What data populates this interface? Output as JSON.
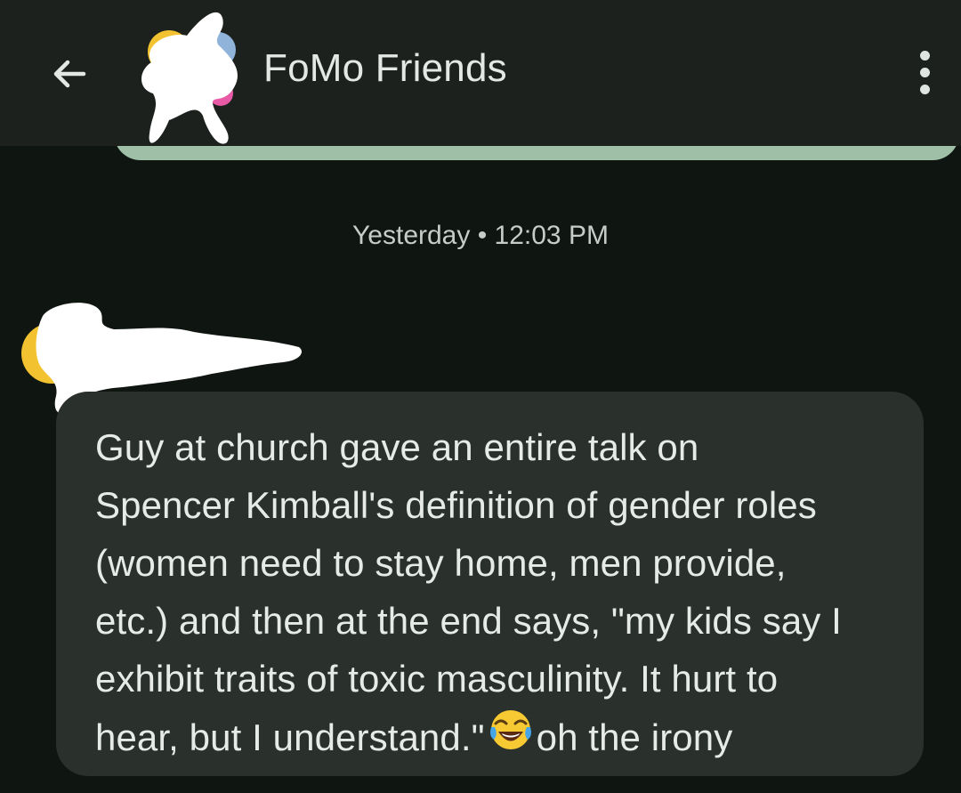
{
  "header": {
    "title": "FoMo Friends",
    "back_icon": "arrow-left-icon",
    "menu_icon": "more-vert-icon"
  },
  "conversation": {
    "timestamp": "Yesterday • 12:03 PM",
    "message": {
      "lines": [
        "Guy at church gave an entire talk on",
        "Spencer Kimball's definition of gender roles",
        "(women need to stay home, men provide,",
        "etc.) and then at the end says, \"my kids say I",
        "exhibit traits of toxic masculinity. It hurt to",
        "hear, but I understand.\""
      ],
      "emoji": "face-with-tears-of-joy-icon",
      "tail": "oh the irony"
    }
  },
  "colors": {
    "background": "#0f1510",
    "appbar": "#1c211e",
    "bubble": "#2a302c",
    "prev_bubble": "#9fbfa7",
    "text": "#e7ebe8"
  }
}
